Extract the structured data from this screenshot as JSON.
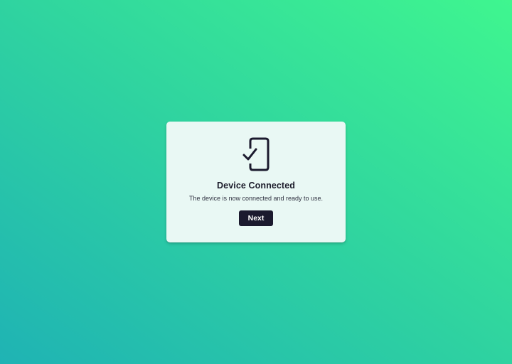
{
  "dialog": {
    "icon": "phone-check-icon",
    "title": "Device Connected",
    "message": "The device is now connected and ready to use.",
    "next_label": "Next"
  },
  "colors": {
    "background_gradient_start": "#1fb3b4",
    "background_gradient_end": "#3ff68f",
    "card_background": "#e9f8f4",
    "primary_button": "#1b1a2e",
    "title_text": "#1c1c2b"
  }
}
